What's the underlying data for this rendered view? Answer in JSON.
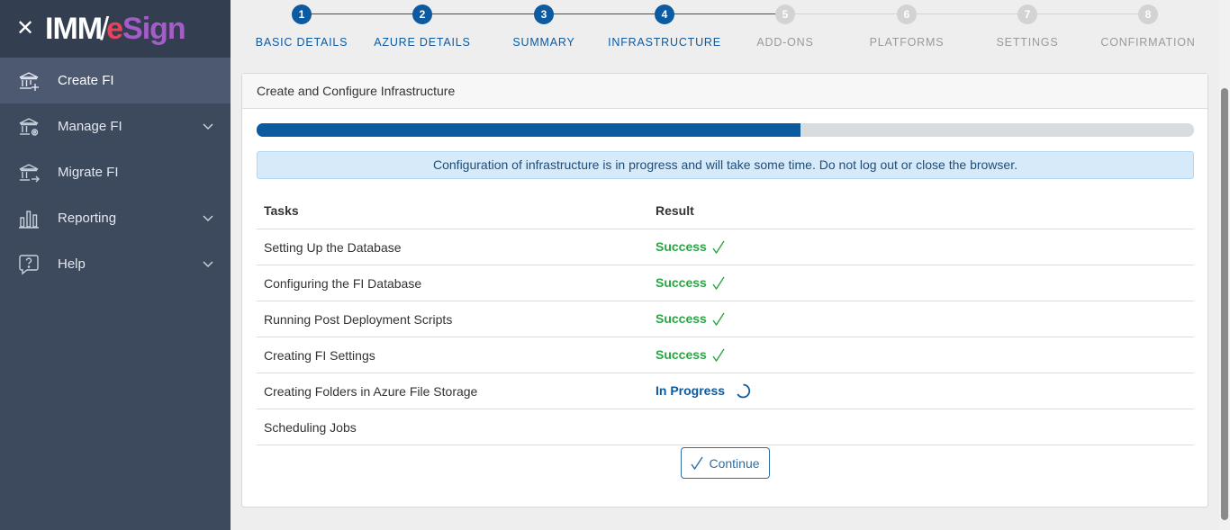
{
  "sidebar": {
    "brand": {
      "imm": "IMM",
      "slash": "/",
      "e": "e",
      "sign": "Sign"
    },
    "items": [
      {
        "label": "Create FI",
        "icon": "bank-add-icon",
        "active": true
      },
      {
        "label": "Manage FI",
        "icon": "bank-gear-icon",
        "has_submenu": true
      },
      {
        "label": "Migrate FI",
        "icon": "bank-arrow-icon"
      },
      {
        "label": "Reporting",
        "icon": "bar-chart-icon",
        "has_submenu": true
      },
      {
        "label": "Help",
        "icon": "help-question-icon",
        "has_submenu": true
      }
    ]
  },
  "stepper": {
    "steps": [
      {
        "number": "1",
        "label": "BASIC DETAILS",
        "state": "done"
      },
      {
        "number": "2",
        "label": "AZURE DETAILS",
        "state": "done"
      },
      {
        "number": "3",
        "label": "SUMMARY",
        "state": "done"
      },
      {
        "number": "4",
        "label": "INFRASTRUCTURE",
        "state": "active"
      },
      {
        "number": "5",
        "label": "ADD-ONS",
        "state": "todo"
      },
      {
        "number": "6",
        "label": "PLATFORMS",
        "state": "todo"
      },
      {
        "number": "7",
        "label": "SETTINGS",
        "state": "todo"
      },
      {
        "number": "8",
        "label": "CONFIRMATION",
        "state": "todo"
      }
    ]
  },
  "card": {
    "title": "Create and Configure Infrastructure",
    "progress_fraction": 0.58,
    "alert": "Configuration of infrastructure is in progress and will take some time. Do not log out or close the browser.",
    "table": {
      "headers": {
        "tasks": "Tasks",
        "result": "Result"
      },
      "rows": [
        {
          "task": "Setting Up the Database",
          "result": "Success",
          "status": "success"
        },
        {
          "task": "Configuring the FI Database",
          "result": "Success",
          "status": "success"
        },
        {
          "task": "Running Post Deployment Scripts",
          "result": "Success",
          "status": "success"
        },
        {
          "task": "Creating FI Settings",
          "result": "Success",
          "status": "success"
        },
        {
          "task": "Creating Folders in Azure File Storage",
          "result": "In Progress",
          "status": "progress"
        },
        {
          "task": "Scheduling Jobs",
          "result": "",
          "status": "pending"
        }
      ]
    },
    "continue_label": "Continue"
  },
  "colors": {
    "sidebar_bg": "#3d4a5e",
    "primary": "#0c5aa0",
    "success": "#28a745",
    "step_inactive": "#d3d3d3"
  }
}
